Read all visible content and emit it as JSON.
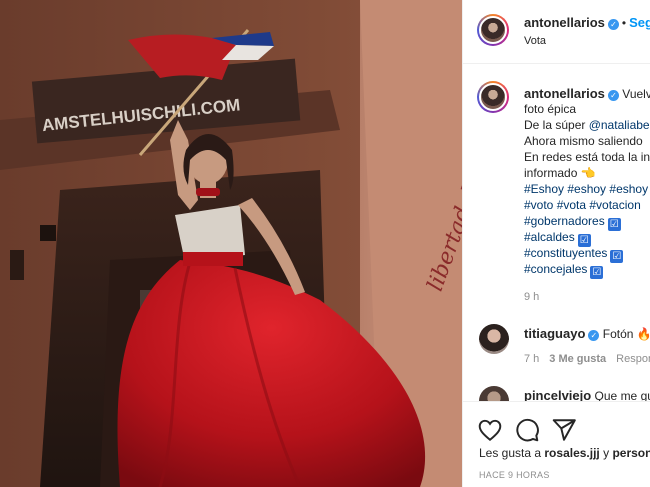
{
  "post": {
    "author": "antonellarios",
    "follow_label": "Seguir",
    "location": "Vota",
    "photo_sign_text": "AMSTELHUISCHILI.COM",
    "photo_wall_text": "libertad de"
  },
  "caption": {
    "author": "antonellarios",
    "line1": "Vuelvo",
    "line2": "foto épica",
    "line3_prefix": "De la súper ",
    "line3_mention": "@nataliabe",
    "line4": "Ahora mismo saliendo",
    "line5": "En redes está toda la in",
    "line6": "informado 👈",
    "hashtags_row1": "#Eshoy #eshoy #eshoy",
    "hashtags_row2": "#voto #vota #votacion",
    "hashtags_list": [
      "#gobernadores",
      "#alcaldes",
      "#constituyentes",
      "#concejales"
    ],
    "checkmark": "☑",
    "time": "9 h"
  },
  "comments": [
    {
      "author": "titiaguayo",
      "text": "Fotón 🔥",
      "time": "7 h",
      "likes": "3 Me gusta",
      "reply": "Respon"
    },
    {
      "author": "pincelviejo",
      "text": "Que me gu"
    }
  ],
  "footer": {
    "likes_prefix": "Les gusta a ",
    "likes_user": "rosales.jjj",
    "likes_suffix": " y ",
    "likes_more": "person",
    "timestamp": "HACE 9 HORAS"
  },
  "icons": [
    "heart-icon",
    "comment-icon",
    "share-icon",
    "verified-icon"
  ],
  "colors": {
    "link": "#00376b",
    "follow": "#0095f6",
    "verified": "#3897f0",
    "dress": "#c0141c"
  }
}
